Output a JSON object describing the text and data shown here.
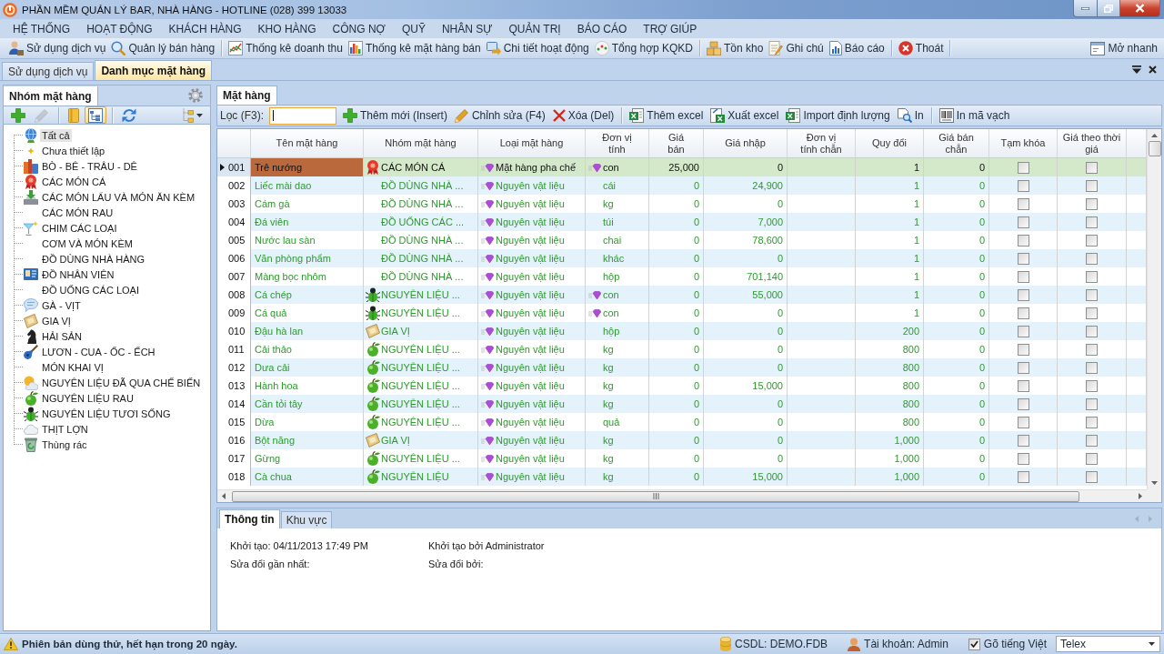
{
  "window": {
    "title": "PHẦN MỀM QUẢN LÝ BAR, NHÀ HÀNG - HOTLINE (028) 399 13033"
  },
  "menu": [
    "HỆ THỐNG",
    "HOẠT ĐỘNG",
    "KHÁCH HÀNG",
    "KHO HÀNG",
    "CÔNG NỢ",
    "QUỸ",
    "NHÂN SỰ",
    "QUẢN TRỊ",
    "BÁO CÁO",
    "TRỢ GIÚP"
  ],
  "toolbar": {
    "groups": [
      {
        "items": [
          {
            "kind": "person",
            "label": "Sử dụng dịch vụ"
          },
          {
            "kind": "search",
            "label": "Quản lý bán hàng"
          }
        ]
      },
      {
        "items": [
          {
            "kind": "linechart",
            "label": "Thống kê doanh thu"
          },
          {
            "kind": "barchart",
            "label": "Thống kê mặt hàng bán"
          },
          {
            "kind": "transfer",
            "label": "Chi tiết hoạt động"
          },
          {
            "kind": "dots",
            "label": "Tổng hợp KQKD"
          }
        ]
      },
      {
        "items": [
          {
            "kind": "boxes",
            "label": "Tồn kho"
          },
          {
            "kind": "note",
            "label": "Ghi chú"
          },
          {
            "kind": "report",
            "label": "Báo cáo"
          }
        ]
      },
      {
        "items": [
          {
            "kind": "exit",
            "label": "Thoát"
          }
        ]
      }
    ],
    "quick_open": {
      "kind": "window",
      "label": "Mở nhanh"
    }
  },
  "document_tabs": [
    {
      "label": "Sử dụng dịch vụ",
      "selected": false
    },
    {
      "label": "Danh mục mặt hàng",
      "selected": true
    }
  ],
  "group_panel": {
    "title": "Nhóm mặt hàng",
    "tools": [
      {
        "items": [
          {
            "kind": "plus",
            "disabled": false,
            "on": false
          },
          {
            "kind": "pencil",
            "disabled": true,
            "on": false
          }
        ]
      },
      {
        "items": [
          {
            "kind": "folder",
            "disabled": false,
            "on": false
          },
          {
            "kind": "tree",
            "disabled": false,
            "on": true
          }
        ]
      },
      {
        "items": [
          {
            "kind": "refresh",
            "disabled": false,
            "on": false
          }
        ]
      }
    ],
    "tree": [
      {
        "label": "Tất cả",
        "kind": "globe",
        "selected": true
      },
      {
        "label": "Chưa thiết lập",
        "kind": "sparkle",
        "selected": false
      },
      {
        "label": "BÒ - BÊ - TRÂU - DÊ",
        "kind": "books",
        "selected": false
      },
      {
        "label": "CÁC MÓN CÁ",
        "kind": "ribbon",
        "selected": false
      },
      {
        "label": "CÁC MÓN LẨU VÀ MÓN ĂN KÈM",
        "kind": "tray",
        "selected": false
      },
      {
        "label": "CÁC MÓN RAU",
        "kind": "plain",
        "selected": false
      },
      {
        "label": "CHIM CÁC LOẠI",
        "kind": "cocktail",
        "selected": false
      },
      {
        "label": "CƠM VÀ MÓN KÈM",
        "kind": "plain",
        "selected": false
      },
      {
        "label": "ĐỒ DÙNG NHÀ HÀNG",
        "kind": "plain",
        "selected": false
      },
      {
        "label": "ĐỒ NHÂN VIÊN",
        "kind": "card",
        "selected": false
      },
      {
        "label": "ĐỒ UỐNG CÁC LOẠI",
        "kind": "plain",
        "selected": false
      },
      {
        "label": "GÀ - VỊT",
        "kind": "bubble",
        "selected": false
      },
      {
        "label": "GIA VỊ",
        "kind": "parchment",
        "selected": false
      },
      {
        "label": "HẢI SẢN",
        "kind": "knight",
        "selected": false
      },
      {
        "label": "LƯƠN - CUA - ỐC - ẾCH",
        "kind": "guitar",
        "selected": false
      },
      {
        "label": "MÓN KHAI VỊ",
        "kind": "plain",
        "selected": false
      },
      {
        "label": "NGUYÊN LIỆU ĐÃ QUA CHẾ BIẾN",
        "kind": "weather",
        "selected": false
      },
      {
        "label": "NGUYÊN LIỆU RAU",
        "kind": "apple",
        "selected": false
      },
      {
        "label": "NGUYÊN LIỆU TƯƠI SỐNG",
        "kind": "beetle",
        "selected": false
      },
      {
        "label": "THỊT LỢN",
        "kind": "cloud",
        "selected": false
      },
      {
        "label": "Thùng rác",
        "kind": "trash",
        "selected": false
      }
    ]
  },
  "item_panel": {
    "tab": "Mặt hàng",
    "filter": {
      "label": "Lọc (F3):",
      "focused": true
    },
    "actions": [
      {
        "items": [
          {
            "kind": "plus",
            "label": "Thêm mới (Insert)"
          },
          {
            "kind": "pencil",
            "label": "Chỉnh sửa (F4)"
          },
          {
            "kind": "cross",
            "label": "Xóa (Del)"
          }
        ]
      },
      {
        "items": [
          {
            "kind": "excel",
            "label": "Thêm excel"
          },
          {
            "kind": "excel_export",
            "label": "Xuất excel"
          },
          {
            "kind": "excel",
            "label": "Import định lượng"
          },
          {
            "kind": "preview",
            "label": "In"
          }
        ]
      },
      {
        "items": [
          {
            "kind": "barcode",
            "label": "In mã vạch"
          }
        ]
      }
    ]
  },
  "table": {
    "columns": [
      "Tên mặt hàng",
      "Nhóm mặt hàng",
      "Loại mặt hàng",
      "Đơn vị tính",
      "Giá bán",
      "Giá nhập",
      "Đơn vị tính chẵn",
      "Quy đổi",
      "Giá bán chẵn",
      "Tạm khóa",
      "Giá theo thời giá"
    ],
    "rows": [
      {
        "no": "001",
        "name": "Trê nướng",
        "group": {
          "label": "CÁC MÓN CÁ",
          "kind": "ribbon"
        },
        "type": "Mặt hàng pha chế",
        "unit": {
          "label": "con",
          "kind": "gem"
        },
        "price": "25,000",
        "cost": "0",
        "conversion": "1",
        "bulk_price": "0",
        "locked": false,
        "time_price": false,
        "selected": true
      },
      {
        "no": "002",
        "name": "Liếc mài dao",
        "group": {
          "label": "ĐỒ DÙNG NHÀ ...",
          "kind": "plain"
        },
        "type": "Nguyên vật liệu",
        "unit": {
          "label": "cái",
          "kind": "plain"
        },
        "price": "0",
        "cost": "24,900",
        "conversion": "1",
        "bulk_price": "0",
        "locked": false,
        "time_price": false,
        "selected": false
      },
      {
        "no": "003",
        "name": "Cám gà",
        "group": {
          "label": "ĐỒ DÙNG NHÀ ...",
          "kind": "plain"
        },
        "type": "Nguyên vật liệu",
        "unit": {
          "label": "kg",
          "kind": "plain"
        },
        "price": "0",
        "cost": "0",
        "conversion": "1",
        "bulk_price": "0",
        "locked": false,
        "time_price": false,
        "selected": false
      },
      {
        "no": "004",
        "name": "Đá viên",
        "group": {
          "label": "ĐỒ UỐNG CÁC ...",
          "kind": "plain"
        },
        "type": "Nguyên vật liệu",
        "unit": {
          "label": "túi",
          "kind": "plain"
        },
        "price": "0",
        "cost": "7,000",
        "conversion": "1",
        "bulk_price": "0",
        "locked": false,
        "time_price": false,
        "selected": false
      },
      {
        "no": "005",
        "name": "Nước lau sàn",
        "group": {
          "label": "ĐỒ DÙNG NHÀ ...",
          "kind": "plain"
        },
        "type": "Nguyên vật liệu",
        "unit": {
          "label": "chai",
          "kind": "plain"
        },
        "price": "0",
        "cost": "78,600",
        "conversion": "1",
        "bulk_price": "0",
        "locked": false,
        "time_price": false,
        "selected": false
      },
      {
        "no": "006",
        "name": "Văn phòng phẩm",
        "group": {
          "label": "ĐỒ DÙNG NHÀ ...",
          "kind": "plain"
        },
        "type": "Nguyên vật liệu",
        "unit": {
          "label": "khác",
          "kind": "plain"
        },
        "price": "0",
        "cost": "0",
        "conversion": "1",
        "bulk_price": "0",
        "locked": false,
        "time_price": false,
        "selected": false
      },
      {
        "no": "007",
        "name": "Màng bọc nhôm",
        "group": {
          "label": "ĐỒ DÙNG NHÀ ...",
          "kind": "plain"
        },
        "type": "Nguyên vật liệu",
        "unit": {
          "label": "hộp",
          "kind": "plain"
        },
        "price": "0",
        "cost": "701,140",
        "conversion": "1",
        "bulk_price": "0",
        "locked": false,
        "time_price": false,
        "selected": false
      },
      {
        "no": "008",
        "name": "Cá chép",
        "group": {
          "label": "NGUYÊN LIỆU ...",
          "kind": "beetle"
        },
        "type": "Nguyên vật liệu",
        "unit": {
          "label": "con",
          "kind": "gem"
        },
        "price": "0",
        "cost": "55,000",
        "conversion": "1",
        "bulk_price": "0",
        "locked": false,
        "time_price": false,
        "selected": false
      },
      {
        "no": "009",
        "name": "Cá quả",
        "group": {
          "label": "NGUYÊN LIỆU ...",
          "kind": "beetle"
        },
        "type": "Nguyên vật liệu",
        "unit": {
          "label": "con",
          "kind": "gem"
        },
        "price": "0",
        "cost": "0",
        "conversion": "1",
        "bulk_price": "0",
        "locked": false,
        "time_price": false,
        "selected": false
      },
      {
        "no": "010",
        "name": "Đậu hà lan",
        "group": {
          "label": "GIA VỊ",
          "kind": "parchment"
        },
        "type": "Nguyên vật liệu",
        "unit": {
          "label": "hộp",
          "kind": "plain"
        },
        "price": "0",
        "cost": "0",
        "conversion": "200",
        "bulk_price": "0",
        "locked": false,
        "time_price": false,
        "selected": false
      },
      {
        "no": "011",
        "name": "Cải thảo",
        "group": {
          "label": "NGUYÊN LIỆU ...",
          "kind": "apple"
        },
        "type": "Nguyên vật liệu",
        "unit": {
          "label": "kg",
          "kind": "plain"
        },
        "price": "0",
        "cost": "0",
        "conversion": "800",
        "bulk_price": "0",
        "locked": false,
        "time_price": false,
        "selected": false
      },
      {
        "no": "012",
        "name": "Dưa cải",
        "group": {
          "label": "NGUYÊN LIỆU ...",
          "kind": "apple"
        },
        "type": "Nguyên vật liệu",
        "unit": {
          "label": "kg",
          "kind": "plain"
        },
        "price": "0",
        "cost": "0",
        "conversion": "800",
        "bulk_price": "0",
        "locked": false,
        "time_price": false,
        "selected": false
      },
      {
        "no": "013",
        "name": "Hành hoa",
        "group": {
          "label": "NGUYÊN LIỆU ...",
          "kind": "apple"
        },
        "type": "Nguyên vật liệu",
        "unit": {
          "label": "kg",
          "kind": "plain"
        },
        "price": "0",
        "cost": "15,000",
        "conversion": "800",
        "bulk_price": "0",
        "locked": false,
        "time_price": false,
        "selected": false
      },
      {
        "no": "014",
        "name": "Cần tỏi tây",
        "group": {
          "label": "NGUYÊN LIỆU ...",
          "kind": "apple"
        },
        "type": "Nguyên vật liệu",
        "unit": {
          "label": "kg",
          "kind": "plain"
        },
        "price": "0",
        "cost": "0",
        "conversion": "800",
        "bulk_price": "0",
        "locked": false,
        "time_price": false,
        "selected": false
      },
      {
        "no": "015",
        "name": "Dừa",
        "group": {
          "label": "NGUYÊN LIỆU ...",
          "kind": "apple"
        },
        "type": "Nguyên vật liệu",
        "unit": {
          "label": "quả",
          "kind": "plain"
        },
        "price": "0",
        "cost": "0",
        "conversion": "800",
        "bulk_price": "0",
        "locked": false,
        "time_price": false,
        "selected": false
      },
      {
        "no": "016",
        "name": "Bột năng",
        "group": {
          "label": "GIA VỊ",
          "kind": "parchment"
        },
        "type": "Nguyên vật liệu",
        "unit": {
          "label": "kg",
          "kind": "plain"
        },
        "price": "0",
        "cost": "0",
        "conversion": "1,000",
        "bulk_price": "0",
        "locked": false,
        "time_price": false,
        "selected": false
      },
      {
        "no": "017",
        "name": "Gừng",
        "group": {
          "label": "NGUYÊN LIỆU ...",
          "kind": "apple"
        },
        "type": "Nguyên vật liệu",
        "unit": {
          "label": "kg",
          "kind": "plain"
        },
        "price": "0",
        "cost": "0",
        "conversion": "1,000",
        "bulk_price": "0",
        "locked": false,
        "time_price": false,
        "selected": false
      },
      {
        "no": "018",
        "name": "Cà chua",
        "group": {
          "label": "NGUYÊN LIỆU",
          "kind": "apple"
        },
        "type": "Nguyên vật liệu",
        "unit": {
          "label": "kg",
          "kind": "plain"
        },
        "price": "0",
        "cost": "15,000",
        "conversion": "1,000",
        "bulk_price": "0",
        "locked": false,
        "time_price": false,
        "selected": false
      }
    ]
  },
  "details": {
    "tabs": [
      {
        "label": "Thông tin",
        "selected": true
      },
      {
        "label": "Khu vực",
        "selected": false
      }
    ],
    "fields": [
      "Khởi tạo: 04/11/2013 17:49 PM",
      "Khởi tạo bởi Administrator",
      "Sửa đổi gần nhất:",
      "Sửa đổi bởi:"
    ]
  },
  "status_bar": {
    "notice": "Phiên bản dùng thử, hết hạn trong 20 ngày.",
    "database": "CSDL: DEMO.FDB",
    "account": "Tài khoản: Admin",
    "typing": {
      "label": "Gõ tiếng Việt",
      "checked": true
    },
    "input_method": "Telex"
  }
}
